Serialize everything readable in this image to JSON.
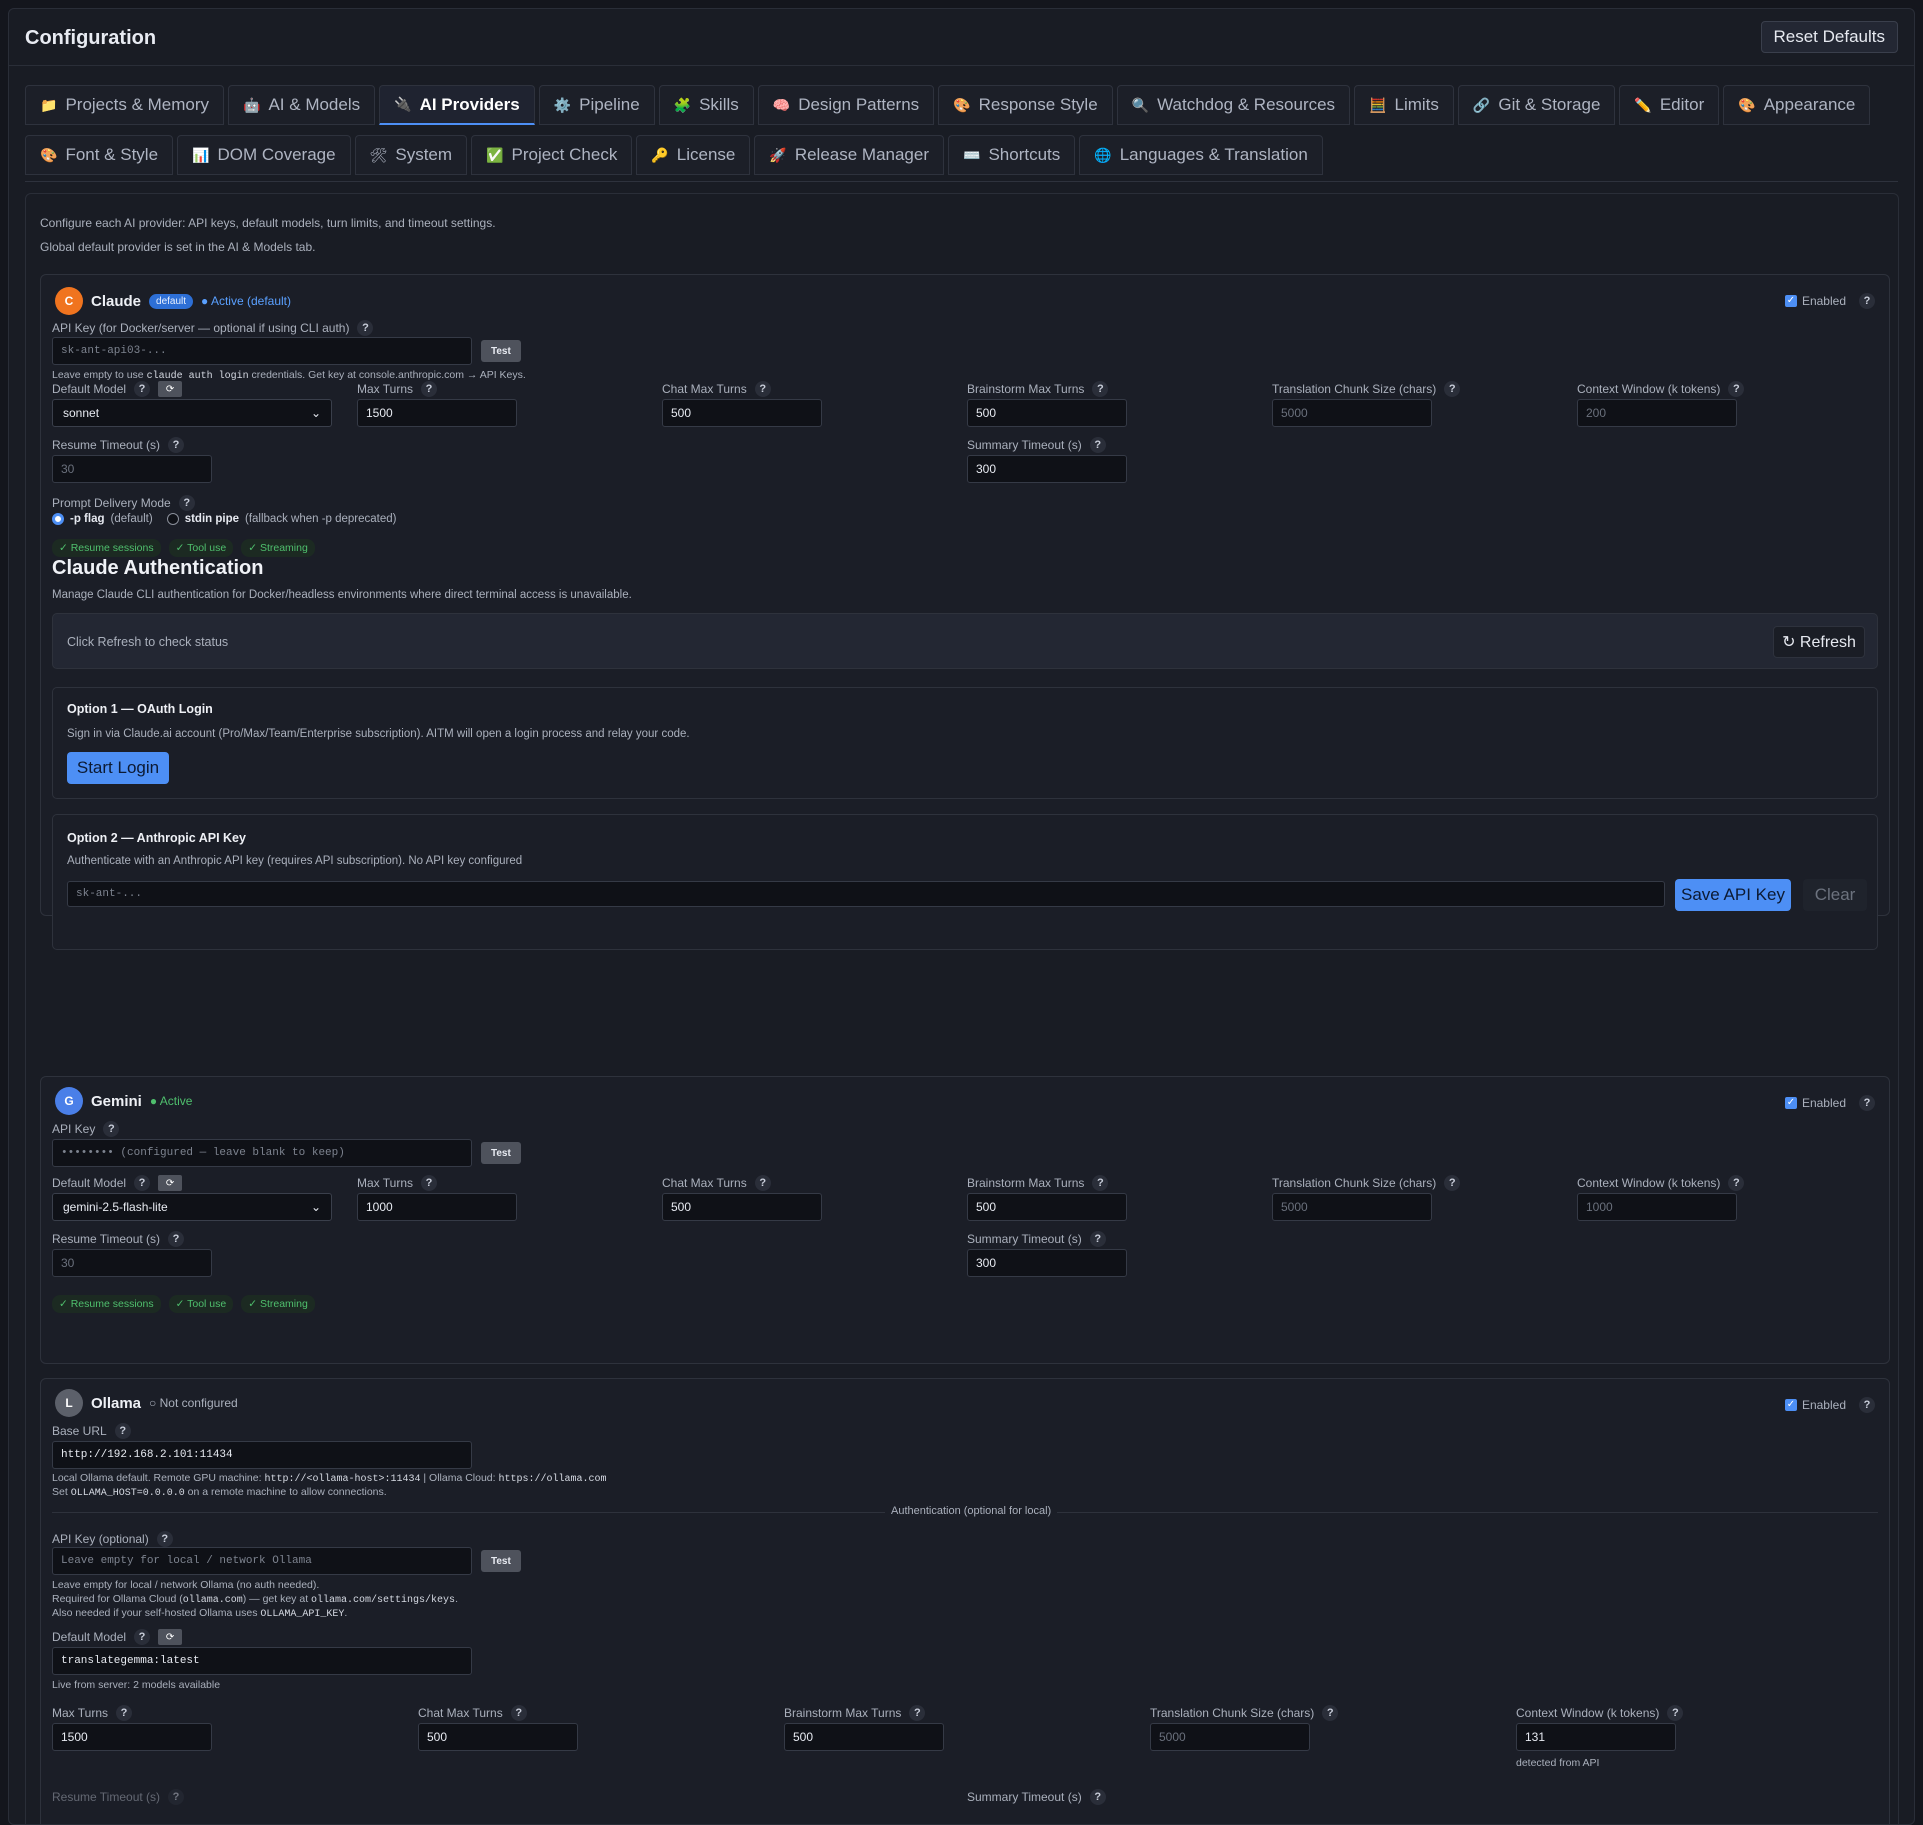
{
  "header": {
    "title": "Configuration",
    "reset_label": "Reset Defaults"
  },
  "tabs": [
    {
      "icon": "📁",
      "label": "Projects & Memory",
      "name": "tab-projects-memory"
    },
    {
      "icon": "🤖",
      "label": "AI & Models",
      "name": "tab-ai-models"
    },
    {
      "icon": "🔌",
      "label": "AI Providers",
      "name": "tab-ai-providers",
      "active": true
    },
    {
      "icon": "⚙️",
      "label": "Pipeline",
      "name": "tab-pipeline"
    },
    {
      "icon": "🧩",
      "label": "Skills",
      "name": "tab-skills"
    },
    {
      "icon": "🧠",
      "label": "Design Patterns",
      "name": "tab-design-patterns"
    },
    {
      "icon": "🎨",
      "label": "Response Style",
      "name": "tab-response-style"
    },
    {
      "icon": "🔍",
      "label": "Watchdog & Resources",
      "name": "tab-watchdog-resources"
    },
    {
      "icon": "🧮",
      "label": "Limits",
      "name": "tab-limits"
    },
    {
      "icon": "🔗",
      "label": "Git & Storage",
      "name": "tab-git-storage"
    },
    {
      "icon": "✏️",
      "label": "Editor",
      "name": "tab-editor"
    },
    {
      "icon": "🎨",
      "label": "Appearance",
      "name": "tab-appearance"
    },
    {
      "icon": "🎨",
      "label": "Font & Style",
      "name": "tab-font-style"
    },
    {
      "icon": "📊",
      "label": "DOM Coverage",
      "name": "tab-dom-coverage"
    },
    {
      "icon": "🛠",
      "label": "System",
      "name": "tab-system"
    },
    {
      "icon": "✅",
      "label": "Project Check",
      "name": "tab-project-check"
    },
    {
      "icon": "🔑",
      "label": "License",
      "name": "tab-license"
    },
    {
      "icon": "🚀",
      "label": "Release Manager",
      "name": "tab-release-manager"
    },
    {
      "icon": "⌨️",
      "label": "Shortcuts",
      "name": "tab-shortcuts"
    },
    {
      "icon": "🌐",
      "label": "Languages & Translation",
      "name": "tab-languages-translation"
    }
  ],
  "intro": {
    "line1": "Configure each AI provider: API keys, default models, turn limits, and timeout settings.",
    "line2": "Global default provider is set in the AI & Models tab."
  },
  "common": {
    "enabled": "Enabled",
    "help": "?",
    "test": "Test",
    "refresh_icon": "⟳",
    "default_model": "Default Model",
    "max_turns": "Max Turns",
    "chat_max_turns": "Chat Max Turns",
    "brainstorm_max_turns": "Brainstorm Max Turns",
    "chunk_size": "Translation Chunk Size (chars)",
    "context_window": "Context Window (k tokens)",
    "resume_timeout": "Resume Timeout (s)",
    "summary_timeout": "Summary Timeout (s)",
    "tags": [
      "✓ Resume sessions",
      "✓ Tool use",
      "✓ Streaming"
    ]
  },
  "claude": {
    "avatar": "C",
    "name": "Claude",
    "badge": "default",
    "status": "● Active (default)",
    "api_key_label": "API Key (for Docker/server — optional if using CLI auth)",
    "api_key_placeholder": "sk-ant-api03-...",
    "hint_pre": "Leave empty to use ",
    "hint_code": "claude auth login",
    "hint_post": " credentials. Get key at console.anthropic.com → API Keys.",
    "model": "sonnet",
    "max_turns": "1500",
    "chat_max_turns": "500",
    "brainstorm_max_turns": "500",
    "chunk_size": "5000",
    "context_window": "200",
    "resume_timeout": "30",
    "summary_timeout": "300",
    "prompt_mode_label": "Prompt Delivery Mode",
    "mode1_bold": "-p flag",
    "mode1_rest": "(default)",
    "mode2_bold": "stdin pipe",
    "mode2_rest": "(fallback when -p deprecated)"
  },
  "auth": {
    "title": "Claude Authentication",
    "desc": "Manage Claude CLI authentication for Docker/headless environments where direct terminal access is unavailable.",
    "status": "Click Refresh to check status",
    "refresh": "↻ Refresh",
    "opt1_title": "Option 1 — OAuth Login",
    "opt1_desc": "Sign in via Claude.ai account (Pro/Max/Team/Enterprise subscription). AITM will open a login process and relay your code.",
    "start_login": "Start Login",
    "opt2_title": "Option 2 — Anthropic API Key",
    "opt2_desc": "Authenticate with an Anthropic API key (requires API subscription). No API key configured",
    "api_placeholder": "sk-ant-...",
    "save": "Save API Key",
    "clear": "Clear"
  },
  "gemini": {
    "avatar": "G",
    "name": "Gemini",
    "status": "● Active",
    "api_key_label": "API Key",
    "api_key_placeholder": "•••••••• (configured — leave blank to keep)",
    "model": "gemini-2.5-flash-lite",
    "max_turns": "1000",
    "chat_max_turns": "500",
    "brainstorm_max_turns": "500",
    "chunk_size": "5000",
    "context_window": "1000",
    "resume_timeout": "30",
    "summary_timeout": "300"
  },
  "ollama": {
    "avatar": "L",
    "name": "Ollama",
    "status": "○ Not configured",
    "base_url_label": "Base URL",
    "base_url": "http://192.168.2.101:11434",
    "hint1_a": "Local Ollama default. Remote GPU machine: ",
    "hint1_code1": "http://<ollama-host>:11434",
    "hint1_b": " | Ollama Cloud: ",
    "hint1_code2": "https://ollama.com",
    "hint2_a": "Set ",
    "hint2_code": "OLLAMA_HOST=0.0.0.0",
    "hint2_b": " on a remote machine to allow connections.",
    "auth_divider": "Authentication (optional for local)",
    "api_key_label": "API Key (optional)",
    "api_key_placeholder": "Leave empty for local / network Ollama",
    "akh1": "Leave empty for local / network Ollama (no auth needed).",
    "akh2_a": "Required for Ollama Cloud (",
    "akh2_code1": "ollama.com",
    "akh2_b": ") — get key at ",
    "akh2_code2": "ollama.com/settings/keys",
    "akh2_c": ".",
    "akh3_a": "Also needed if your self-hosted Ollama uses ",
    "akh3_code": "OLLAMA_API_KEY",
    "akh3_b": ".",
    "model": "translategemma:latest",
    "model_hint": "Live from server: 2 models available",
    "max_turns": "1500",
    "chat_max_turns": "500",
    "brainstorm_max_turns": "500",
    "chunk_size": "5000",
    "context_window": "131",
    "context_hint": "detected from API"
  },
  "colors": {
    "accent": "#4d8ff5",
    "claude": "#f0741f",
    "gemini": "#4a7fe8",
    "ollama": "#5c606a",
    "active": "#4fbf6d",
    "claude_status": "#5aa0ff"
  }
}
